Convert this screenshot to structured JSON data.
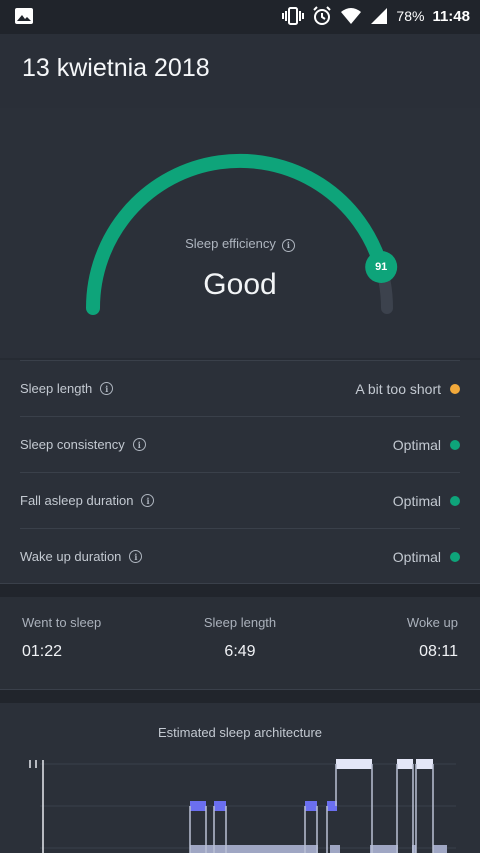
{
  "status_bar": {
    "battery": "78%",
    "time": "11:48",
    "icons": [
      "image-icon",
      "vibrate-icon",
      "alarm-icon",
      "wifi-icon",
      "signal-icon",
      "battery-icon"
    ]
  },
  "header": {
    "date": "13 kwietnia 2018"
  },
  "efficiency": {
    "label": "Sleep efficiency",
    "rating": "Good",
    "score": "91",
    "score_fraction": 0.91,
    "color": "#0ea47a"
  },
  "metrics": [
    {
      "label": "Sleep length",
      "status": "A bit too short",
      "color": "#f2a93b"
    },
    {
      "label": "Sleep consistency",
      "status": "Optimal",
      "color": "#0ea47a"
    },
    {
      "label": "Fall asleep duration",
      "status": "Optimal",
      "color": "#0ea47a"
    },
    {
      "label": "Wake up duration",
      "status": "Optimal",
      "color": "#0ea47a"
    }
  ],
  "times": {
    "went_to_sleep": {
      "label": "Went to sleep",
      "value": "01:22"
    },
    "sleep_length": {
      "label": "Sleep length",
      "value": "6:49"
    },
    "woke_up": {
      "label": "Woke up",
      "value": "08:11"
    }
  },
  "architecture": {
    "title": "Estimated sleep architecture",
    "colors": {
      "awake": "#e3e6f7",
      "rem": "#6b6ff0",
      "light": "#9fa6c3"
    }
  }
}
